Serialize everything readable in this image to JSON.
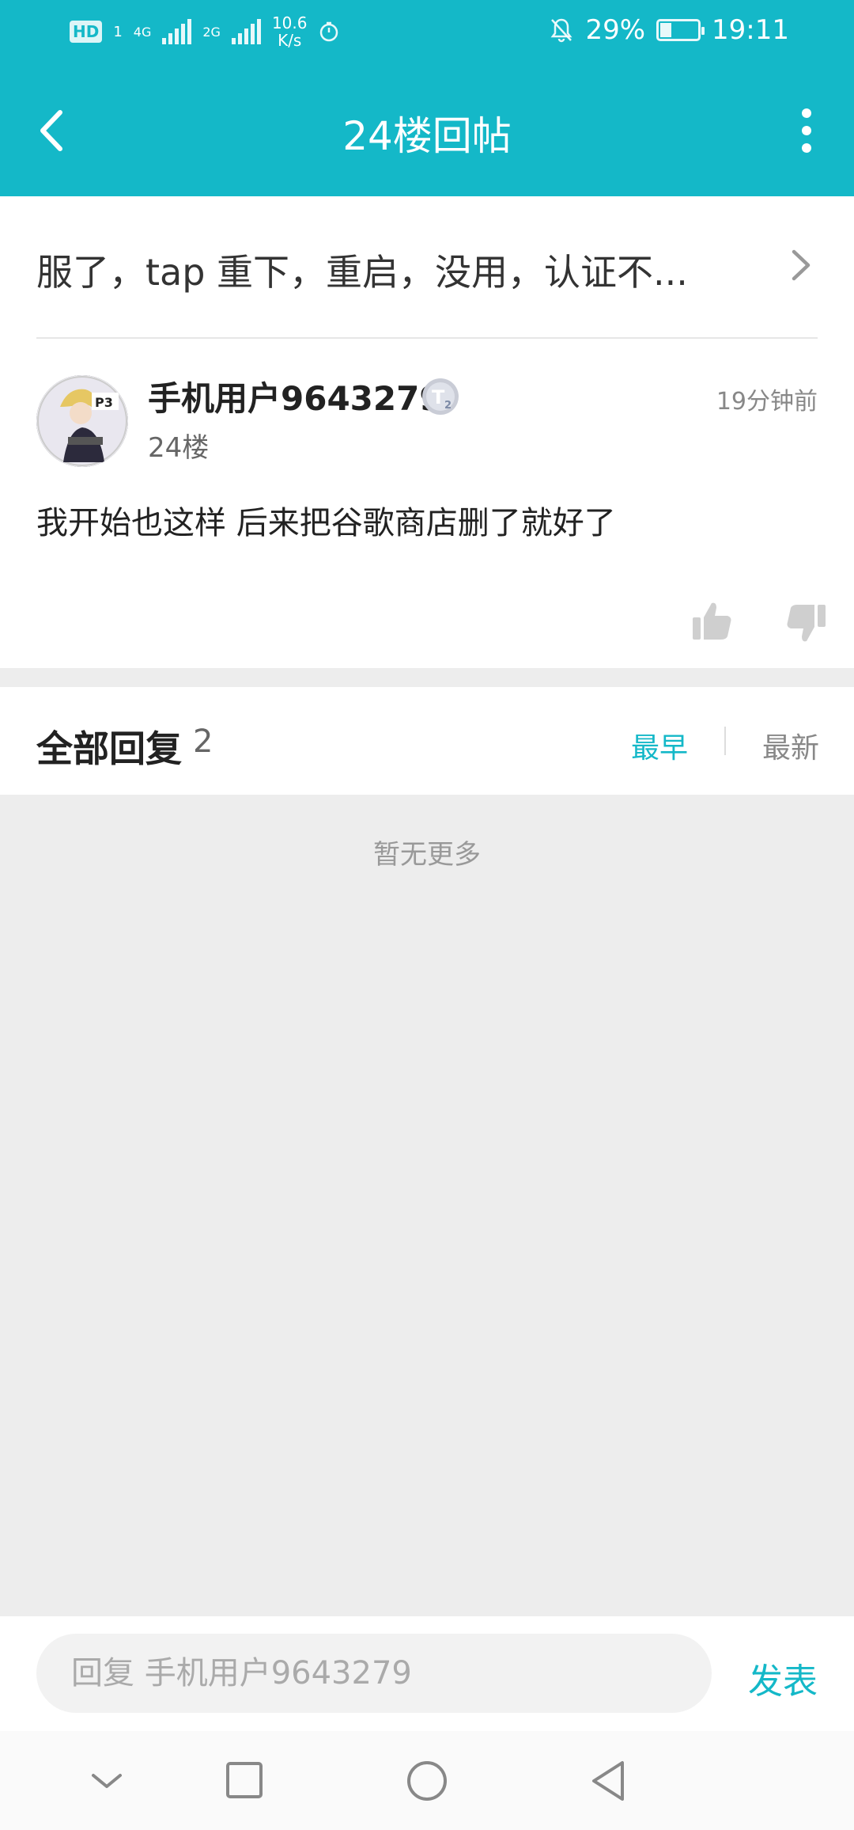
{
  "status_bar": {
    "network_badge": "HD",
    "sim": "1",
    "net1": "4G",
    "net2": "2G",
    "speed_value": "10.6",
    "speed_unit": "K/s",
    "battery": "29%",
    "time": "19:11"
  },
  "header": {
    "title": "24楼回帖"
  },
  "thread": {
    "title": "服了，tap 重下，重启，没用，认证不..."
  },
  "post": {
    "username": "手机用户9643279",
    "level_icon": "T2 level badge",
    "floor": "24楼",
    "time": "19分钟前",
    "content": "我开始也这样 后来把谷歌商店删了就好了"
  },
  "replies": {
    "title": "全部回复",
    "count": "2",
    "sort_earliest": "最早",
    "sort_latest": "最新",
    "active_sort": "最早",
    "empty_text": "暂无更多"
  },
  "reply_box": {
    "placeholder": "回复 手机用户9643279",
    "submit_label": "发表"
  },
  "colors": {
    "accent": "#14b8c8"
  }
}
